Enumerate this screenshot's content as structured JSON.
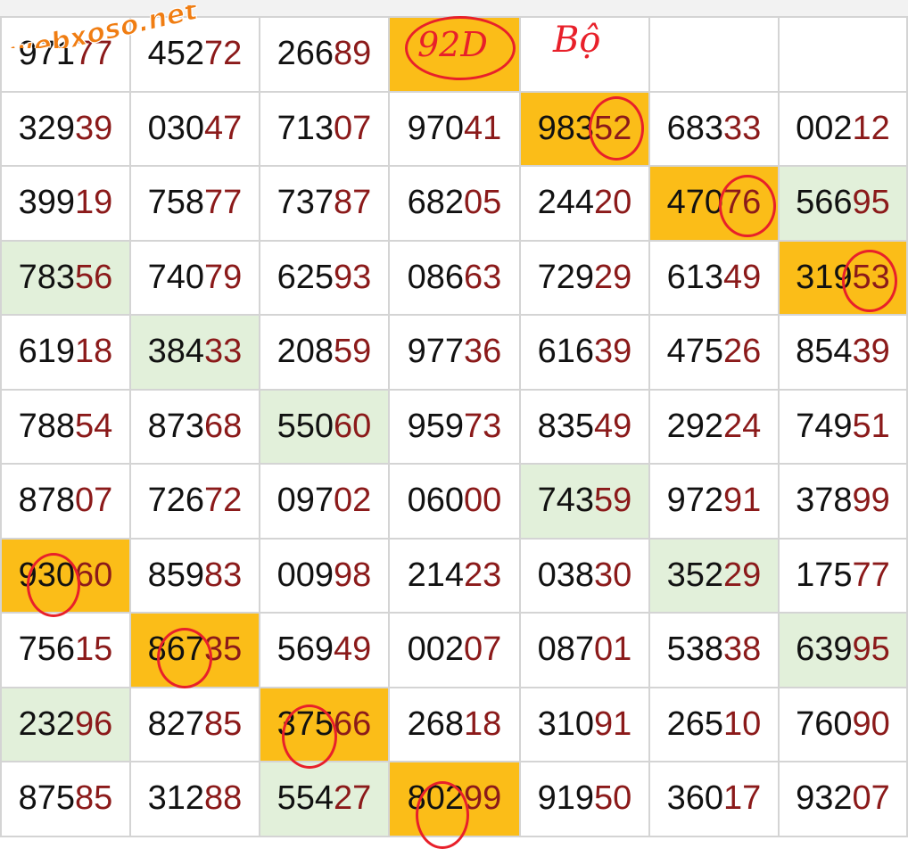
{
  "watermark": "webxoso.net",
  "annotations": {
    "box_note": "92D",
    "side_note": "Bộ"
  },
  "colors": {
    "orange": "#fbbd18",
    "green": "#e2f0da",
    "prefix": "#111111",
    "suffix": "#8b1a1a",
    "marker": "#e8202a"
  },
  "rows": [
    [
      {
        "p": "971",
        "s": "77",
        "h": ""
      },
      {
        "p": "452",
        "s": "72",
        "h": ""
      },
      {
        "p": "266",
        "s": "89",
        "h": ""
      },
      {
        "p": "",
        "s": "",
        "h": "orange"
      },
      {
        "p": "",
        "s": "",
        "h": ""
      },
      {
        "p": "",
        "s": "",
        "h": ""
      },
      {
        "p": "",
        "s": "",
        "h": ""
      }
    ],
    [
      {
        "p": "329",
        "s": "39",
        "h": ""
      },
      {
        "p": "030",
        "s": "47",
        "h": ""
      },
      {
        "p": "713",
        "s": "07",
        "h": ""
      },
      {
        "p": "970",
        "s": "41",
        "h": ""
      },
      {
        "p": "983",
        "s": "52",
        "h": "orange"
      },
      {
        "p": "683",
        "s": "33",
        "h": ""
      },
      {
        "p": "002",
        "s": "12",
        "h": ""
      }
    ],
    [
      {
        "p": "399",
        "s": "19",
        "h": ""
      },
      {
        "p": "758",
        "s": "77",
        "h": ""
      },
      {
        "p": "737",
        "s": "87",
        "h": ""
      },
      {
        "p": "682",
        "s": "05",
        "h": ""
      },
      {
        "p": "244",
        "s": "20",
        "h": ""
      },
      {
        "p": "470",
        "s": "76",
        "h": "orange"
      },
      {
        "p": "566",
        "s": "95",
        "h": "green"
      }
    ],
    [
      {
        "p": "783",
        "s": "56",
        "h": "green"
      },
      {
        "p": "740",
        "s": "79",
        "h": ""
      },
      {
        "p": "625",
        "s": "93",
        "h": ""
      },
      {
        "p": "086",
        "s": "63",
        "h": ""
      },
      {
        "p": "729",
        "s": "29",
        "h": ""
      },
      {
        "p": "613",
        "s": "49",
        "h": ""
      },
      {
        "p": "319",
        "s": "53",
        "h": "orange"
      }
    ],
    [
      {
        "p": "619",
        "s": "18",
        "h": ""
      },
      {
        "p": "384",
        "s": "33",
        "h": "green"
      },
      {
        "p": "208",
        "s": "59",
        "h": ""
      },
      {
        "p": "977",
        "s": "36",
        "h": ""
      },
      {
        "p": "616",
        "s": "39",
        "h": ""
      },
      {
        "p": "475",
        "s": "26",
        "h": ""
      },
      {
        "p": "854",
        "s": "39",
        "h": ""
      }
    ],
    [
      {
        "p": "788",
        "s": "54",
        "h": ""
      },
      {
        "p": "873",
        "s": "68",
        "h": ""
      },
      {
        "p": "550",
        "s": "60",
        "h": "green"
      },
      {
        "p": "959",
        "s": "73",
        "h": ""
      },
      {
        "p": "835",
        "s": "49",
        "h": ""
      },
      {
        "p": "292",
        "s": "24",
        "h": ""
      },
      {
        "p": "749",
        "s": "51",
        "h": ""
      }
    ],
    [
      {
        "p": "878",
        "s": "07",
        "h": ""
      },
      {
        "p": "726",
        "s": "72",
        "h": ""
      },
      {
        "p": "097",
        "s": "02",
        "h": ""
      },
      {
        "p": "060",
        "s": "00",
        "h": ""
      },
      {
        "p": "743",
        "s": "59",
        "h": "green"
      },
      {
        "p": "972",
        "s": "91",
        "h": ""
      },
      {
        "p": "378",
        "s": "99",
        "h": ""
      }
    ],
    [
      {
        "p": "930",
        "s": "60",
        "h": "orange"
      },
      {
        "p": "859",
        "s": "83",
        "h": ""
      },
      {
        "p": "009",
        "s": "98",
        "h": ""
      },
      {
        "p": "214",
        "s": "23",
        "h": ""
      },
      {
        "p": "038",
        "s": "30",
        "h": ""
      },
      {
        "p": "352",
        "s": "29",
        "h": "green"
      },
      {
        "p": "175",
        "s": "77",
        "h": ""
      }
    ],
    [
      {
        "p": "756",
        "s": "15",
        "h": ""
      },
      {
        "p": "867",
        "s": "35",
        "h": "orange"
      },
      {
        "p": "569",
        "s": "49",
        "h": ""
      },
      {
        "p": "002",
        "s": "07",
        "h": ""
      },
      {
        "p": "087",
        "s": "01",
        "h": ""
      },
      {
        "p": "538",
        "s": "38",
        "h": ""
      },
      {
        "p": "639",
        "s": "95",
        "h": "green"
      }
    ],
    [
      {
        "p": "232",
        "s": "96",
        "h": "green"
      },
      {
        "p": "827",
        "s": "85",
        "h": ""
      },
      {
        "p": "375",
        "s": "66",
        "h": "orange"
      },
      {
        "p": "268",
        "s": "18",
        "h": ""
      },
      {
        "p": "310",
        "s": "91",
        "h": ""
      },
      {
        "p": "265",
        "s": "10",
        "h": ""
      },
      {
        "p": "760",
        "s": "90",
        "h": ""
      }
    ],
    [
      {
        "p": "875",
        "s": "85",
        "h": ""
      },
      {
        "p": "312",
        "s": "88",
        "h": ""
      },
      {
        "p": "554",
        "s": "27",
        "h": "green"
      },
      {
        "p": "802",
        "s": "99",
        "h": "orange"
      },
      {
        "p": "919",
        "s": "50",
        "h": ""
      },
      {
        "p": "360",
        "s": "17",
        "h": ""
      },
      {
        "p": "932",
        "s": "07",
        "h": ""
      }
    ]
  ]
}
